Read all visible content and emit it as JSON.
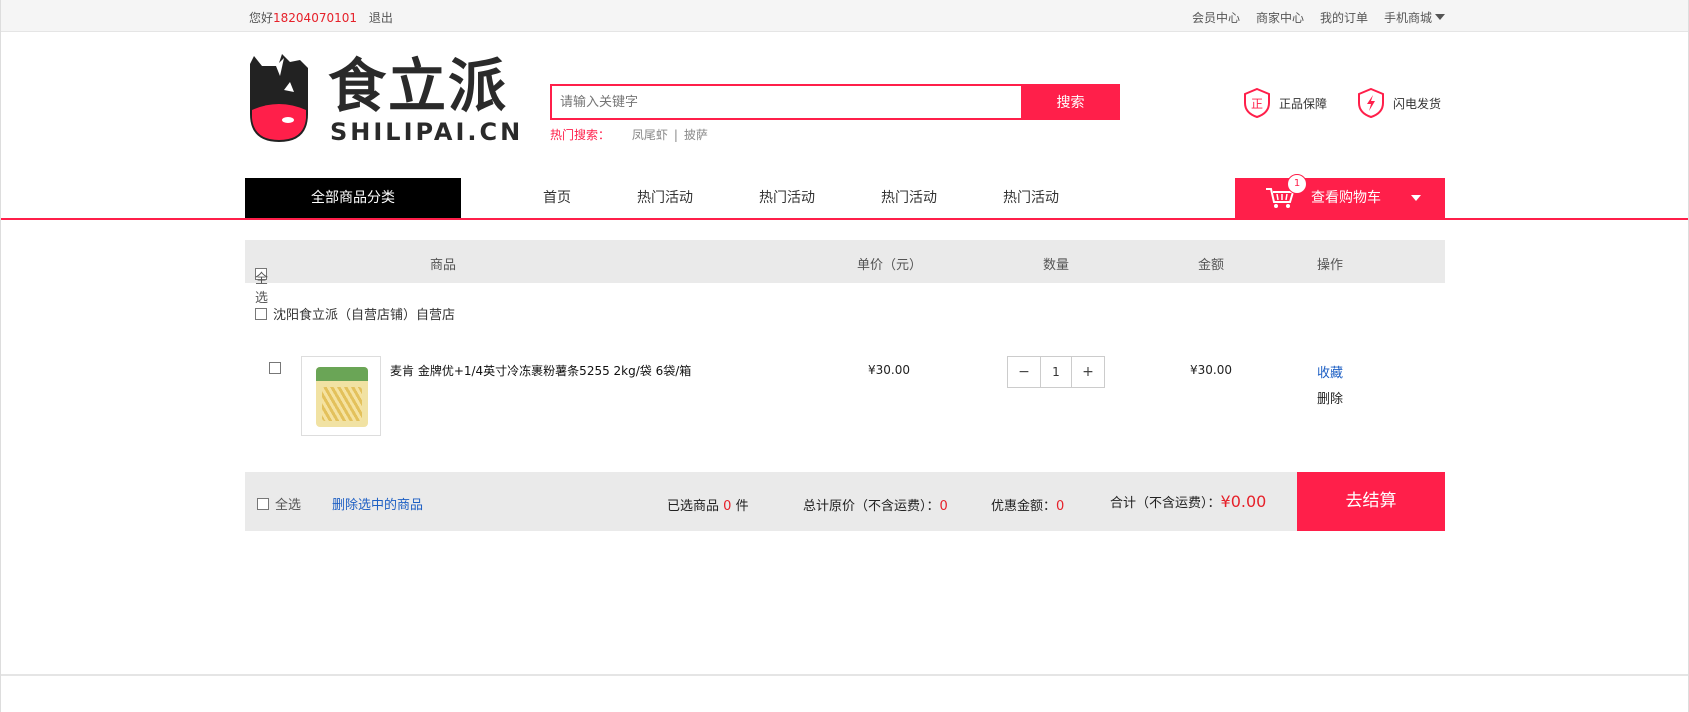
{
  "topbar": {
    "greeting": "您好",
    "phone": "18204070101",
    "logout": "退出",
    "links": [
      "会员中心",
      "商家中心",
      "我的订单",
      "手机商城"
    ]
  },
  "logo": {
    "cn": "食立派",
    "en": "SHILIPAI.CN"
  },
  "search": {
    "placeholder": "请输入关键字",
    "button": "搜索",
    "hot_label": "热门搜索：",
    "hot_terms": [
      "凤尾虾",
      "披萨"
    ]
  },
  "badges": [
    "正品保障",
    "闪电发货"
  ],
  "badge_icons": [
    "shield-zheng-icon",
    "shield-lightning-icon"
  ],
  "nav": {
    "all_categories": "全部商品分类",
    "links": [
      "首页",
      "热门活动",
      "热门活动",
      "热门活动",
      "热门活动"
    ],
    "cart_label": "查看购物车",
    "cart_count": "1"
  },
  "table_header": {
    "select_all": "全选",
    "product": "商品",
    "unit_price": "单价（元）",
    "quantity": "数量",
    "amount": "金额",
    "action": "操作"
  },
  "store": {
    "name": "沈阳食立派（自营店铺）自营店"
  },
  "items": [
    {
      "name": "麦肯 金牌优+1/4英寸冷冻裹粉薯条5255 2kg/袋 6袋/箱",
      "price": "¥30.00",
      "quantity": "1",
      "amount": "¥30.00",
      "favorite": "收藏",
      "delete": "删除"
    }
  ],
  "footer": {
    "select_all": "全选",
    "delete_selected": "删除选中的商品",
    "selected_label": "已选商品",
    "selected_count": "0",
    "selected_unit": "件",
    "original_label": "总计原价（不含运费）：",
    "original_value": "0",
    "discount_label": "优惠金额：",
    "discount_value": "0",
    "total_label": "合计（不含运费）：",
    "total_value": "¥0.00",
    "checkout": "去结算"
  },
  "colors": {
    "accent": "#ff1f4a",
    "link": "#1d5fc4",
    "nav_dark": "#000000"
  }
}
